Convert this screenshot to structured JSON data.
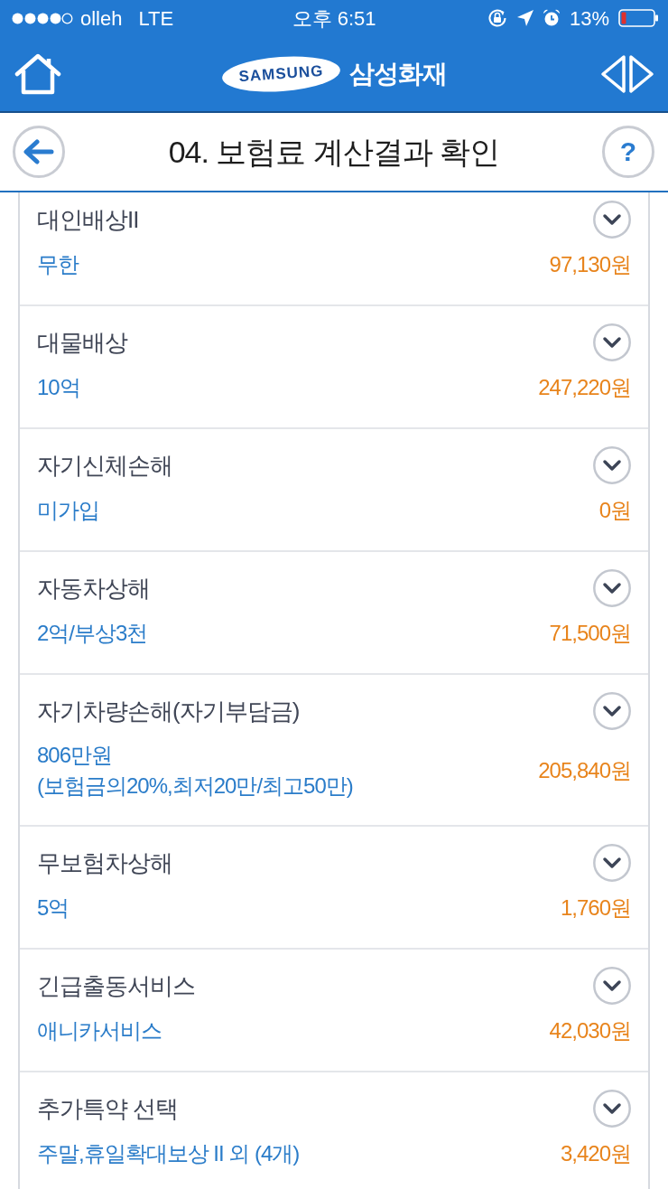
{
  "status_bar": {
    "carrier": "olleh",
    "network": "LTE",
    "time": "오후 6:51",
    "battery": "13%"
  },
  "app_header": {
    "logo_text": "SAMSUNG",
    "title": "삼성화재"
  },
  "page_header": {
    "title": "04. 보험료 계산결과 확인",
    "help_label": "?"
  },
  "coverages": [
    {
      "name": "대인배상II",
      "detail": [
        "무한"
      ],
      "premium": "97,130원",
      "expanded": false
    },
    {
      "name": "대물배상",
      "detail": [
        "10억"
      ],
      "premium": "247,220원",
      "expanded": false
    },
    {
      "name": "자기신체손해",
      "detail": [
        "미가입"
      ],
      "premium": "0원",
      "expanded": false
    },
    {
      "name": "자동차상해",
      "detail": [
        "2억/부상3천"
      ],
      "premium": "71,500원",
      "expanded": false
    },
    {
      "name": "자기차량손해(자기부담금)",
      "detail": [
        "806만원",
        "(보험금의20%,최저20만/최고50만)"
      ],
      "premium": "205,840원",
      "expanded": false
    },
    {
      "name": "무보험차상해",
      "detail": [
        "5억"
      ],
      "premium": "1,760원",
      "expanded": false
    },
    {
      "name": "긴급출동서비스",
      "detail": [
        "애니카서비스"
      ],
      "premium": "42,030원",
      "expanded": false
    },
    {
      "name": "추가특약 선택",
      "detail": [
        "주말,휴일확대보상 II 외 (4개)"
      ],
      "premium": "3,420원",
      "expanded": false
    }
  ]
}
